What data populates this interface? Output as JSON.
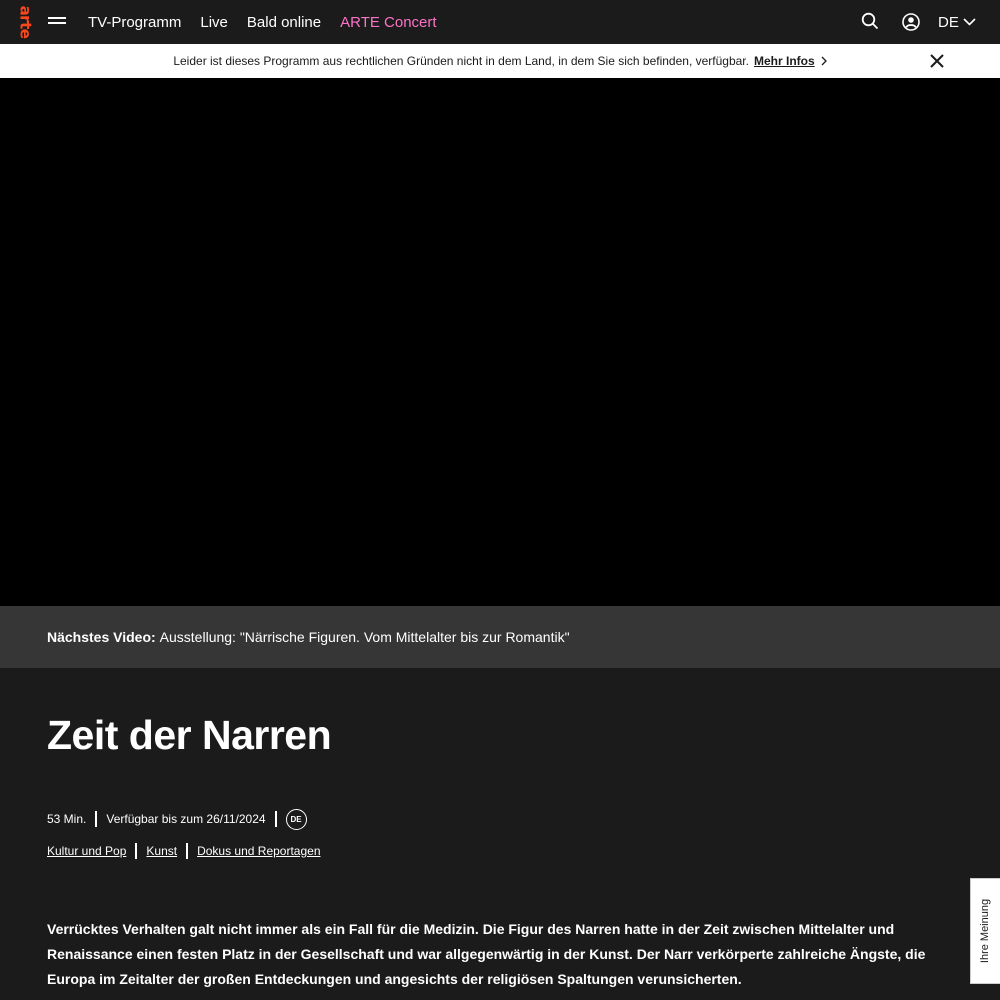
{
  "header": {
    "logo": "arte",
    "menu_icon": "hamburger-menu-icon",
    "nav": [
      {
        "label": "TV-Programm"
      },
      {
        "label": "Live"
      },
      {
        "label": "Bald online"
      },
      {
        "label": "ARTE Concert",
        "color": "#fd73c8"
      }
    ],
    "search_icon": "search-icon",
    "user_icon": "user-icon",
    "language": "DE"
  },
  "notice": {
    "message": "Leider ist dieses Programm aus rechtlichen Gründen nicht in dem Land, in dem Sie sich befinden, verfügbar.",
    "more_label": "Mehr Infos"
  },
  "next_video": {
    "label": "Nächstes Video:",
    "title": "Ausstellung: \"Närrische Figuren. Vom Mittelalter bis zur Romantik\""
  },
  "program": {
    "title": "Zeit der Narren",
    "duration": "53 Min.",
    "availability": "Verfügbar bis zum 26/11/2024",
    "language_badge": "DE",
    "categories": [
      "Kultur und Pop",
      "Kunst",
      "Dokus und Reportagen"
    ],
    "description": "Verrücktes Verhalten galt nicht immer als ein Fall für die Medizin. Die Figur des Narren hatte in der Zeit zwischen Mittelalter und Renaissance einen festen Platz in der Gesellschaft und war allgegenwärtig in der Kunst. Der Narr verkörperte zahlreiche Ängste, die Europa im Zeitalter der großen Entdeckungen und angesichts der religiösen Spaltungen verunsicherten."
  },
  "feedback": {
    "label": "Ihre Meinung"
  },
  "colors": {
    "brand": "#fa481c",
    "background": "#1b1b1b",
    "next_bar": "#363636",
    "concert": "#fd73c8"
  }
}
